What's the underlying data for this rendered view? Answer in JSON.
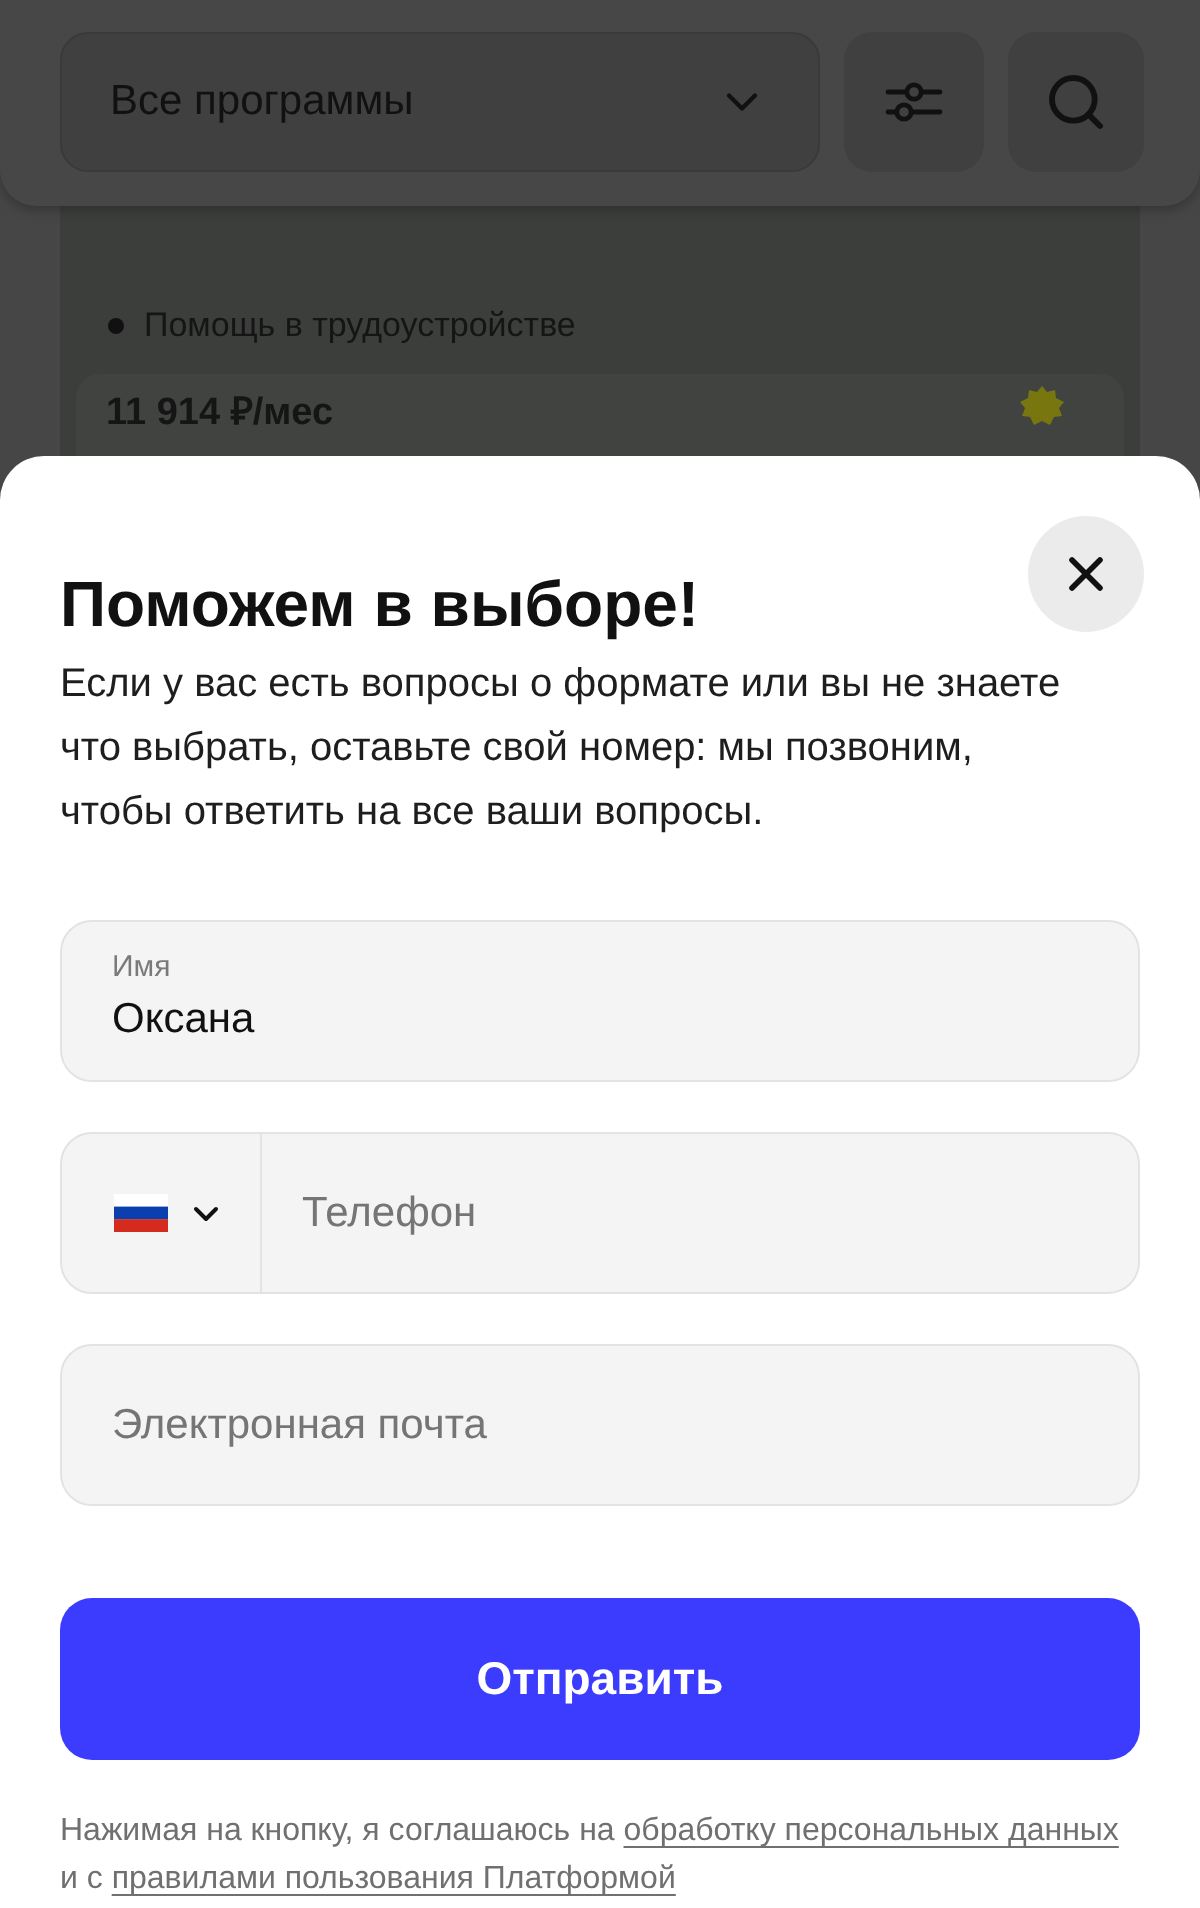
{
  "header": {
    "program_select": {
      "value": "Все программы"
    }
  },
  "background_card": {
    "features": [
      "Помощь в трудоустройстве"
    ],
    "price": "11 914 ₽/мес"
  },
  "modal": {
    "title": "Поможем в выборе!",
    "description": "Если у вас есть вопросы о формате или вы не знаете что выбрать, оставьте свой номер: мы позвоним, чтобы ответить на все ваши вопросы.",
    "fields": [
      {
        "kind": "text",
        "label": "Имя",
        "value": "Оксана"
      },
      {
        "kind": "phone",
        "placeholder": "Телефон"
      },
      {
        "kind": "text",
        "placeholder": "Электронная почта"
      }
    ],
    "submit_button": "Отправить",
    "consent": [
      {
        "kind": "plain",
        "text": "Нажимая на кнопку, я соглашаюсь на "
      },
      {
        "kind": "link",
        "text": "обработку персональных данных"
      },
      {
        "kind": "plain",
        "text": " и с "
      },
      {
        "kind": "link",
        "text": "правилами пользования Платформой"
      }
    ]
  }
}
